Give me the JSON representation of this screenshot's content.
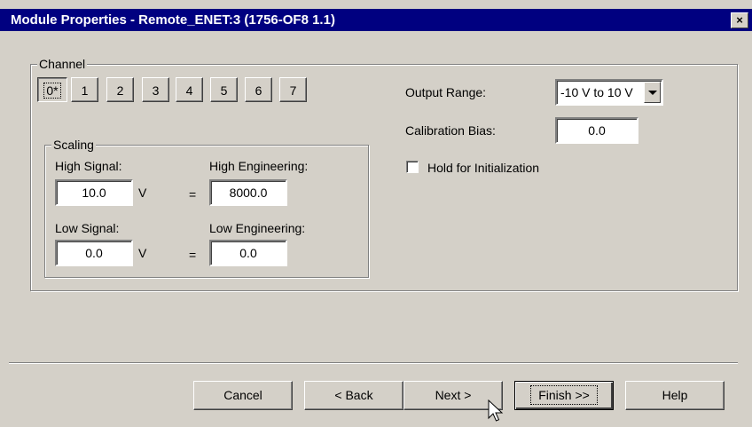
{
  "window": {
    "title": "Module Properties - Remote_ENET:3 (1756-OF8 1.1)",
    "close": "×"
  },
  "channel": {
    "label": "Channel",
    "tabs": [
      "0*",
      "1",
      "2",
      "3",
      "4",
      "5",
      "6",
      "7"
    ],
    "selected": "0*"
  },
  "scaling": {
    "label": "Scaling",
    "high_signal_label": "High Signal:",
    "high_signal_value": "10.0",
    "high_signal_unit": "V",
    "high_eng_label": "High Engineering:",
    "high_eng_value": "8000.0",
    "low_signal_label": "Low Signal:",
    "low_signal_value": "0.0",
    "low_signal_unit": "V",
    "low_eng_label": "Low Engineering:",
    "low_eng_value": "0.0",
    "equals": "="
  },
  "output": {
    "range_label": "Output Range:",
    "range_value": "-10 V to 10 V",
    "bias_label": "Calibration Bias:",
    "bias_value": "0.0",
    "hold_label": "Hold for Initialization",
    "hold_checked": false
  },
  "buttons": {
    "cancel": "Cancel",
    "back": "< Back",
    "next": "Next >",
    "finish": "Finish >>",
    "help": "Help"
  }
}
